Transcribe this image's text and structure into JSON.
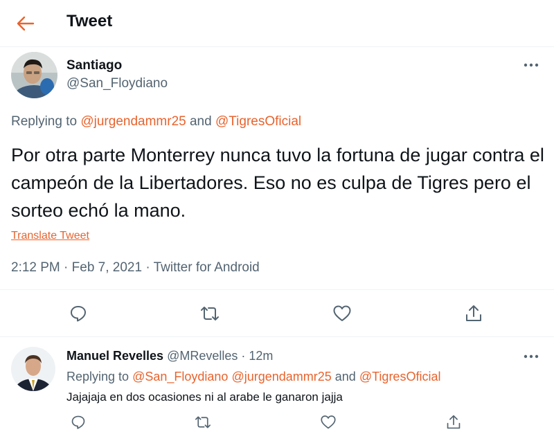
{
  "header": {
    "title": "Tweet",
    "back_icon": "arrow-left-icon",
    "accent": "#e8632d"
  },
  "tweet": {
    "author_name": "Santiago",
    "author_handle": "@San_Floydiano",
    "replying_prefix": "Replying to ",
    "replying_user1": "@jurgendammr25",
    "replying_and": " and ",
    "replying_user2": "@TigresOficial",
    "text": "Por otra parte Monterrey nunca tuvo la fortuna de jugar contra el campeón de la Libertadores. Eso no es culpa de Tigres pero el sorteo echó la mano.",
    "translate_label": "Translate Tweet",
    "time": "2:12 PM",
    "sep": " · ",
    "date": "Feb 7, 2021",
    "source": "Twitter for Android",
    "actions": [
      "reply-icon",
      "retweet-icon",
      "like-icon",
      "share-icon"
    ]
  },
  "reply": {
    "author_name": "Manuel Revelles",
    "author_handle": "@MRevelles",
    "sep": " · ",
    "time": "12m",
    "replying_prefix": "Replying to ",
    "replying_user1": "@San_Floydiano",
    "replying_space": " ",
    "replying_user2": "@jurgendammr25",
    "replying_and": " and ",
    "replying_user3": "@TigresOficial",
    "text": "Jajajaja en dos ocasiones ni al arabe le ganaron jajja"
  }
}
